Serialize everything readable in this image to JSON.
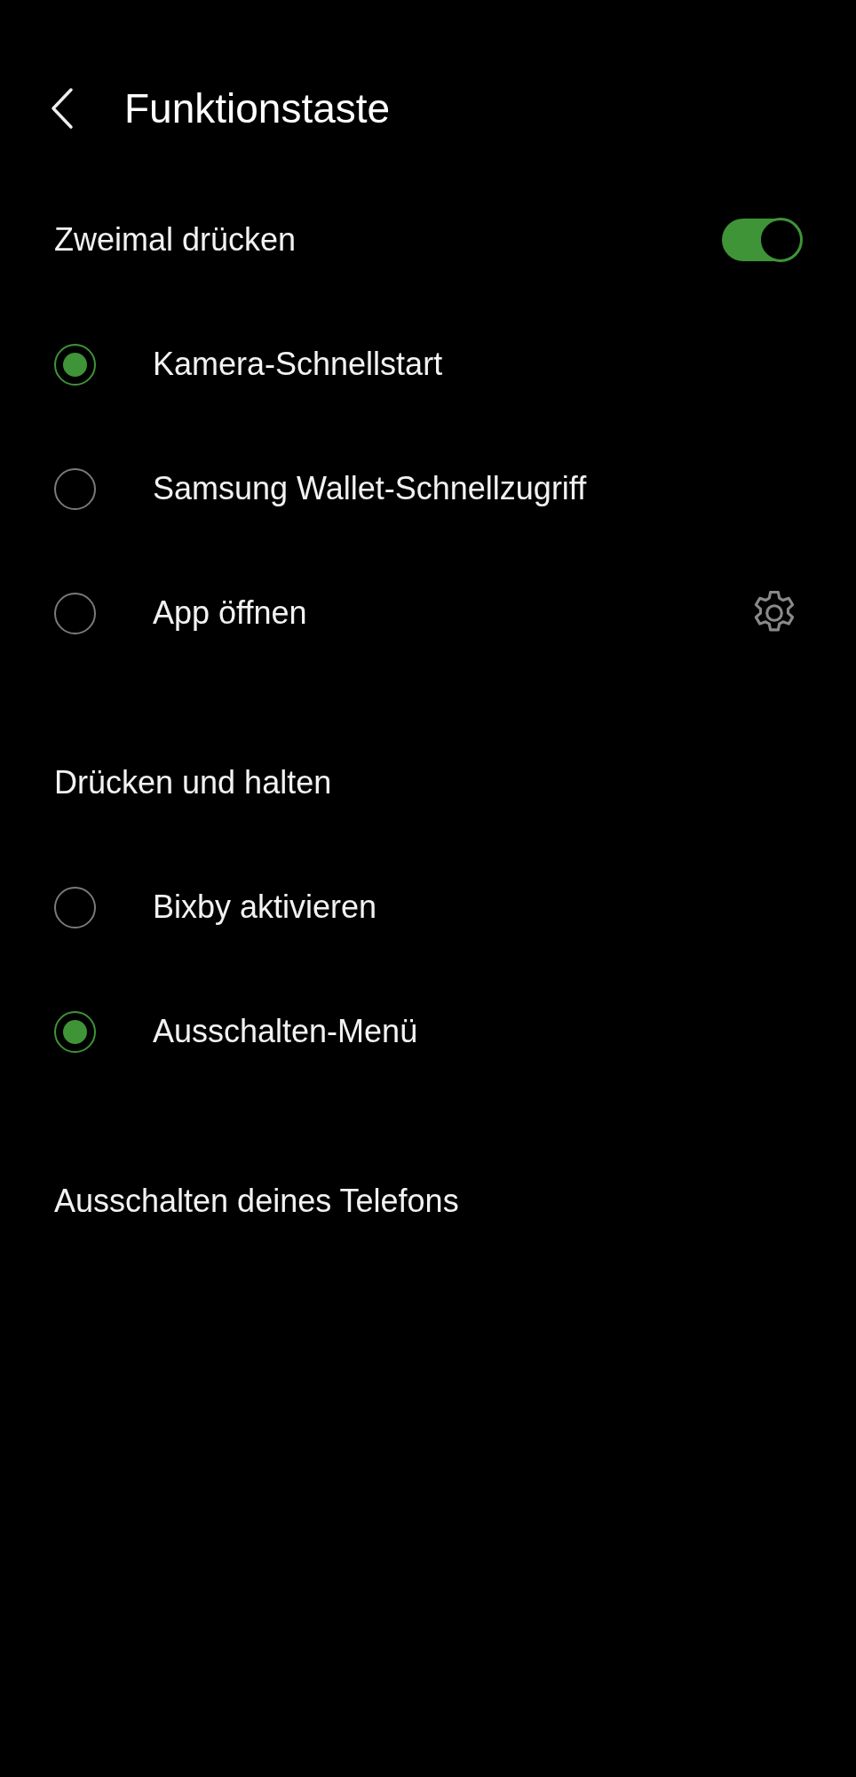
{
  "header": {
    "title": "Funktionstaste"
  },
  "sections": [
    {
      "title": "Zweimal drücken",
      "toggle": {
        "on": true
      },
      "options": [
        {
          "label": "Kamera-Schnellstart",
          "selected": true,
          "has_settings": false
        },
        {
          "label": "Samsung Wallet-Schnellzugriff",
          "selected": false,
          "has_settings": false
        },
        {
          "label": "App öffnen",
          "selected": false,
          "has_settings": true
        }
      ]
    },
    {
      "title": "Drücken und halten",
      "options": [
        {
          "label": "Bixby aktivieren",
          "selected": false,
          "has_settings": false
        },
        {
          "label": "Ausschalten-Menü",
          "selected": true,
          "has_settings": false
        }
      ]
    }
  ],
  "footer_link": "Ausschalten deines Telefons"
}
